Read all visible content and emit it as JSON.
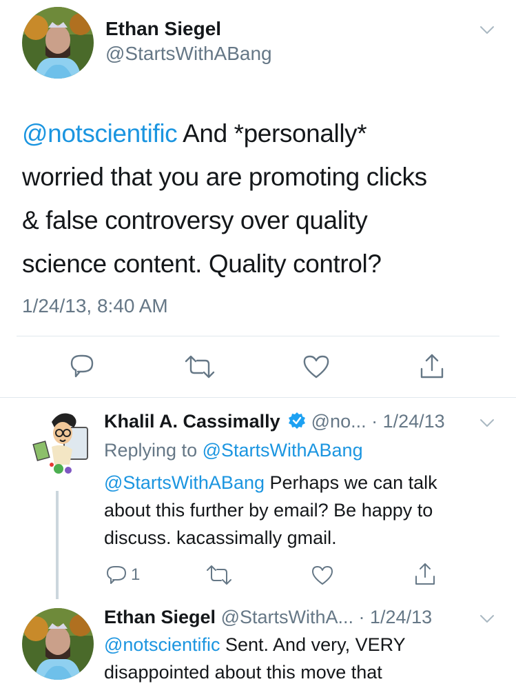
{
  "main_tweet": {
    "author_name": "Ethan Siegel",
    "author_handle": "@StartsWithABang",
    "mention": "@notscientific",
    "text_line1_rest": " And *personally*",
    "text_line2": "worried that you are promoting clicks",
    "text_line3": "& false controversy over quality",
    "text_line4": "science content. Quality control?",
    "timestamp": "1/24/13, 8:40 AM",
    "actions": [
      "reply-icon",
      "retweet-icon",
      "like-icon",
      "share-icon"
    ]
  },
  "reply1": {
    "author_name": "Khalil A. Cassimally",
    "handle_truncated": "@no...",
    "dot_date": "· 1/24/13",
    "replying_prefix": "Replying to ",
    "replying_handle": "@StartsWithABang",
    "mention": "@StartsWithABang",
    "text_line1_rest": " Perhaps we can talk",
    "text_line2": "about this further by email? Be happy to",
    "text_line3": "discuss. kacassimally gmail.",
    "reply_count": "1"
  },
  "reply2": {
    "author_name": "Ethan Siegel",
    "handle_truncated": "@StartsWithA...",
    "dot_date": "· 1/24/13",
    "mention": "@notscientific",
    "text_line1_rest": " Sent. And very, VERY",
    "text_line2": "disappointed about this move that"
  },
  "colors": {
    "link_blue": "#1b95e0",
    "secondary_gray": "#657786",
    "divider": "#e1e8ed",
    "verified_blue": "#1da1f2"
  }
}
